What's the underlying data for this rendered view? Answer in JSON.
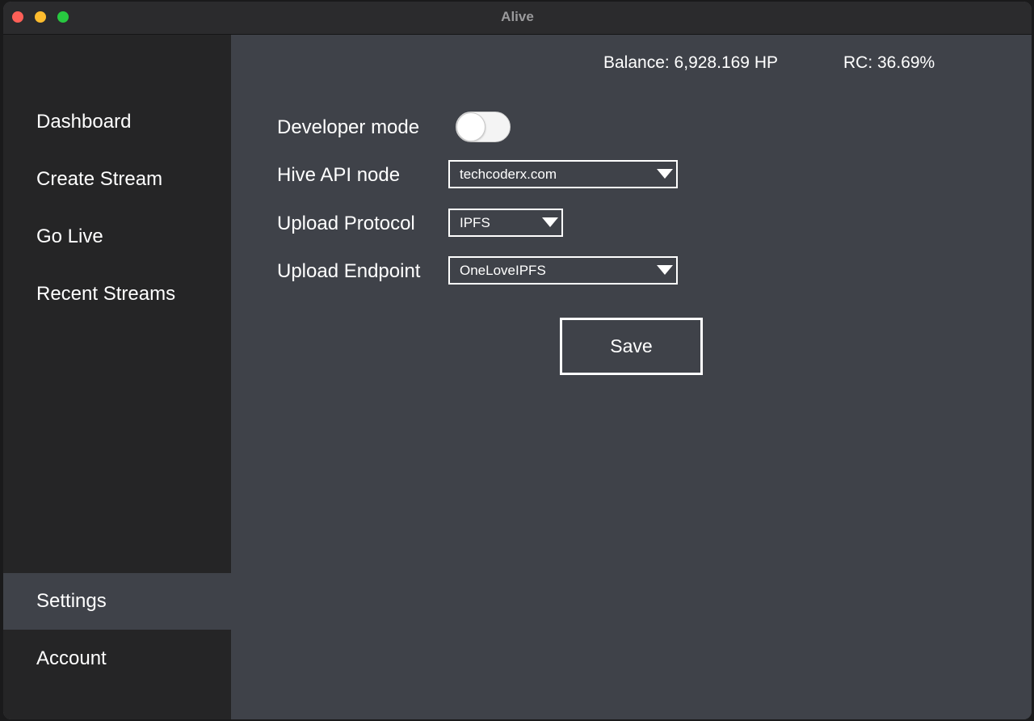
{
  "window": {
    "title": "Alive"
  },
  "sidebar": {
    "items": [
      {
        "label": "Dashboard"
      },
      {
        "label": "Create Stream"
      },
      {
        "label": "Go Live"
      },
      {
        "label": "Recent Streams"
      },
      {
        "label": "Settings",
        "active": true
      },
      {
        "label": "Account"
      }
    ]
  },
  "stats": {
    "balance": "Balance: 6,928.169 HP",
    "rc": "RC: 36.69%"
  },
  "settings": {
    "developer_mode": {
      "label": "Developer mode",
      "enabled": false
    },
    "hive_api_node": {
      "label": "Hive API node",
      "value": "techcoderx.com"
    },
    "upload_protocol": {
      "label": "Upload Protocol",
      "value": "IPFS"
    },
    "upload_endpoint": {
      "label": "Upload Endpoint",
      "value": "OneLoveIPFS"
    },
    "save_label": "Save"
  },
  "colors": {
    "sidebar_bg": "#252526",
    "main_bg": "#3f4249",
    "active_item_bg": "#3f4249",
    "text": "#ffffff"
  },
  "icons": {
    "dropdown": "chevron-down-icon"
  }
}
